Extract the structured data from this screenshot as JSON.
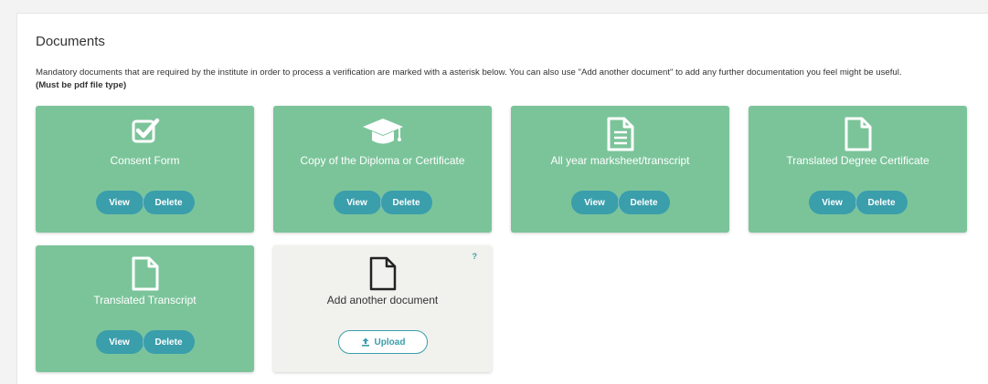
{
  "section": {
    "title": "Documents",
    "description": "Mandatory documents that are required by the institute in order to process a verification are marked with a asterisk below. You can also use \"Add another document\" to add any further documentation you feel might be useful.",
    "note": "(Must be pdf file type)"
  },
  "cards": [
    {
      "label": "Consent Form",
      "icon": "checkbox-icon",
      "view": "View",
      "delete": "Delete"
    },
    {
      "label": "Copy of the Diploma or Certificate",
      "icon": "graduation-cap-icon",
      "view": "View",
      "delete": "Delete"
    },
    {
      "label": "All year marksheet/transcript",
      "icon": "document-lines-icon",
      "view": "View",
      "delete": "Delete"
    },
    {
      "label": "Translated Degree Certificate",
      "icon": "document-icon",
      "view": "View",
      "delete": "Delete"
    },
    {
      "label": "Translated Transcript",
      "icon": "document-icon",
      "view": "View",
      "delete": "Delete"
    }
  ],
  "add_card": {
    "label": "Add another document",
    "icon": "document-icon",
    "upload": "Upload",
    "upload_icon": "upload-icon",
    "help": "?"
  },
  "colors": {
    "card_bg": "#7bc49a",
    "button_bg": "#3a9eab",
    "add_card_bg": "#f1f1ed"
  }
}
